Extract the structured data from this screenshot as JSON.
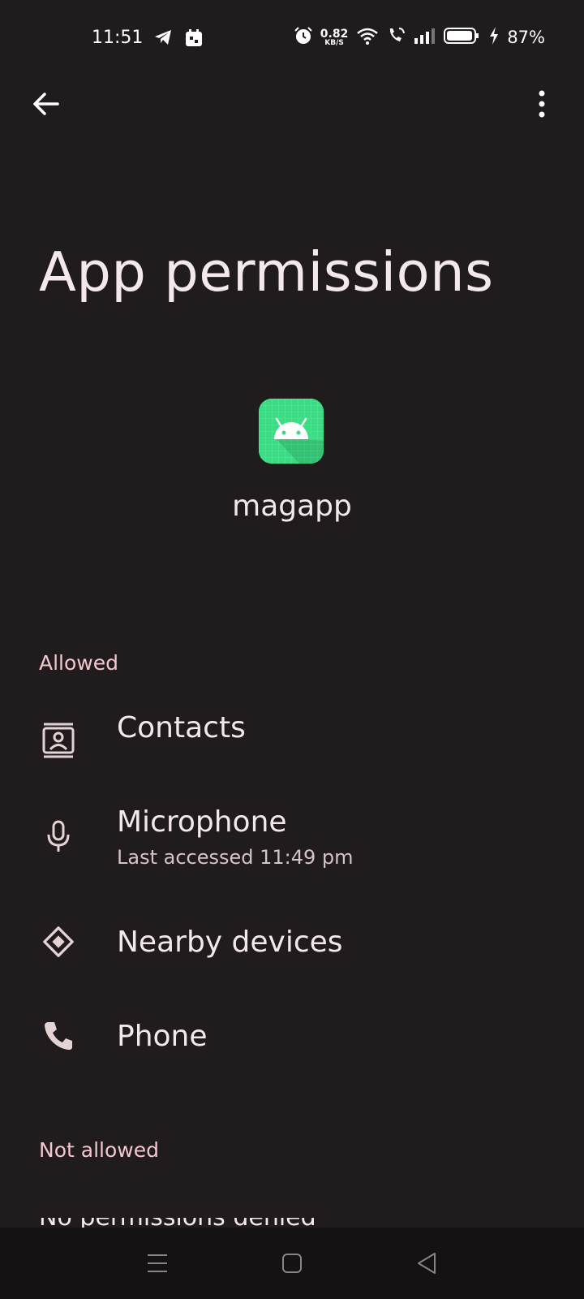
{
  "status_bar": {
    "time": "11:51",
    "net_speed_value": "0.82",
    "net_speed_unit": "KB/S",
    "battery_percent": "87%"
  },
  "header": {
    "title": "App permissions"
  },
  "app": {
    "name": "magapp",
    "icon": "android-robot-icon",
    "icon_color": "#3ddc84"
  },
  "sections": {
    "allowed_label": "Allowed",
    "not_allowed_label": "Not allowed"
  },
  "permissions_allowed": [
    {
      "label": "Contacts",
      "icon": "contacts-icon"
    },
    {
      "label": "Microphone",
      "icon": "microphone-icon",
      "sublabel": "Last accessed 11:49 pm"
    },
    {
      "label": "Nearby devices",
      "icon": "nearby-devices-icon"
    },
    {
      "label": "Phone",
      "icon": "phone-icon"
    }
  ],
  "peek_text": "No permissions denied",
  "colors": {
    "background": "#201b1c",
    "section_header": "#f2c7cd",
    "text_primary": "#f4e9ea"
  }
}
